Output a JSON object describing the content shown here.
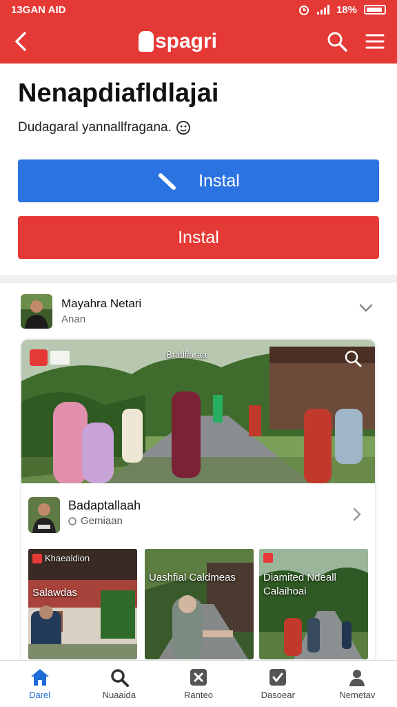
{
  "status": {
    "left": "13GAN AID",
    "right": "18%"
  },
  "app": {
    "brand": "spagri"
  },
  "hero": {
    "title": "Nenapdiafldlajai",
    "subtitle": "Dudagaral yannallfragana.",
    "button_primary": "Instal",
    "button_secondary": "Instal"
  },
  "post": {
    "author": "Mayahra Netari",
    "meta": "Anan"
  },
  "card": {
    "photo_tag": "Bratlflaraa",
    "title": "Badaptallaah",
    "subtitle": "Gemiaan"
  },
  "thumbs": [
    {
      "tag": "Khaealdion",
      "title": "Salawdas"
    },
    {
      "tag": "",
      "title": "Uashfial Caldmeas"
    },
    {
      "tag": "",
      "title": "Diamited Ndeall Calaihoai"
    }
  ],
  "nav": [
    {
      "label": "Darel",
      "icon": "home-icon",
      "active": true
    },
    {
      "label": "Nuaaida",
      "icon": "search-icon",
      "active": false
    },
    {
      "label": "Ranteo",
      "icon": "close-box-icon",
      "active": false
    },
    {
      "label": "Dasoear",
      "icon": "check-box-icon",
      "active": false
    },
    {
      "label": "Nemetav",
      "icon": "profile-icon",
      "active": false
    }
  ],
  "colors": {
    "brand_red": "#e53935",
    "primary_blue": "#2b73e0",
    "nav_active": "#1e6bd6"
  }
}
